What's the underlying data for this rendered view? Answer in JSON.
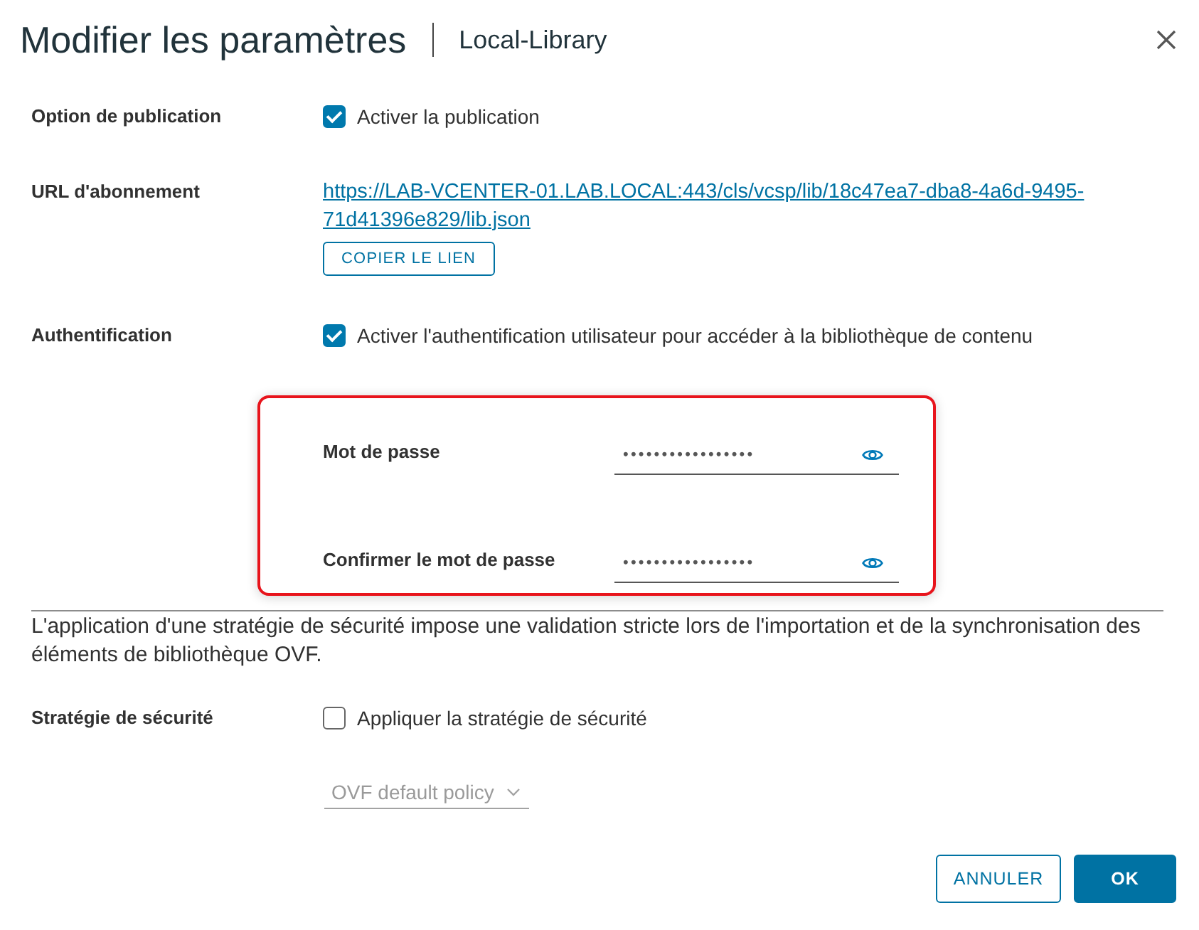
{
  "dialog": {
    "title": "Modifier les paramètres",
    "subtitle": "Local-Library"
  },
  "rows": [
    {
      "kind": "checkbox",
      "label": "Option de publication",
      "checkbox": {
        "label": "Activer la publication",
        "checked": true
      }
    },
    {
      "kind": "link",
      "label": "URL d'abonnement",
      "link": "https://LAB-VCENTER-01.LAB.LOCAL:443/cls/vcsp/lib/18c47ea7-dba8-4a6d-9495-71d41396e829/lib.json",
      "button": "COPIER LE LIEN"
    },
    {
      "kind": "checkbox",
      "label": "Authentification",
      "checkbox": {
        "label": "Activer l'authentification utilisateur pour accéder à la bibliothèque de contenu",
        "checked": true
      }
    }
  ],
  "password_panel": {
    "highlighted": true,
    "fields": [
      {
        "label": "Mot de passe",
        "value": "•••••••••••••••••"
      },
      {
        "label": "Confirmer le mot de passe",
        "value": "•••••••••••••••••"
      }
    ]
  },
  "notice": "L'application d'une stratégie de sécurité impose une validation stricte lors de l'importation et de la synchronisation des éléments de bibliothèque OVF.",
  "security": {
    "label": "Stratégie de sécurité",
    "checkbox": {
      "label": "Appliquer la stratégie de sécurité",
      "checked": false
    },
    "policy": {
      "value": "OVF default policy",
      "disabled": true
    }
  },
  "buttons": [
    {
      "label": "ANNULER",
      "kind": "secondary"
    },
    {
      "label": "OK",
      "kind": "primary"
    }
  ]
}
